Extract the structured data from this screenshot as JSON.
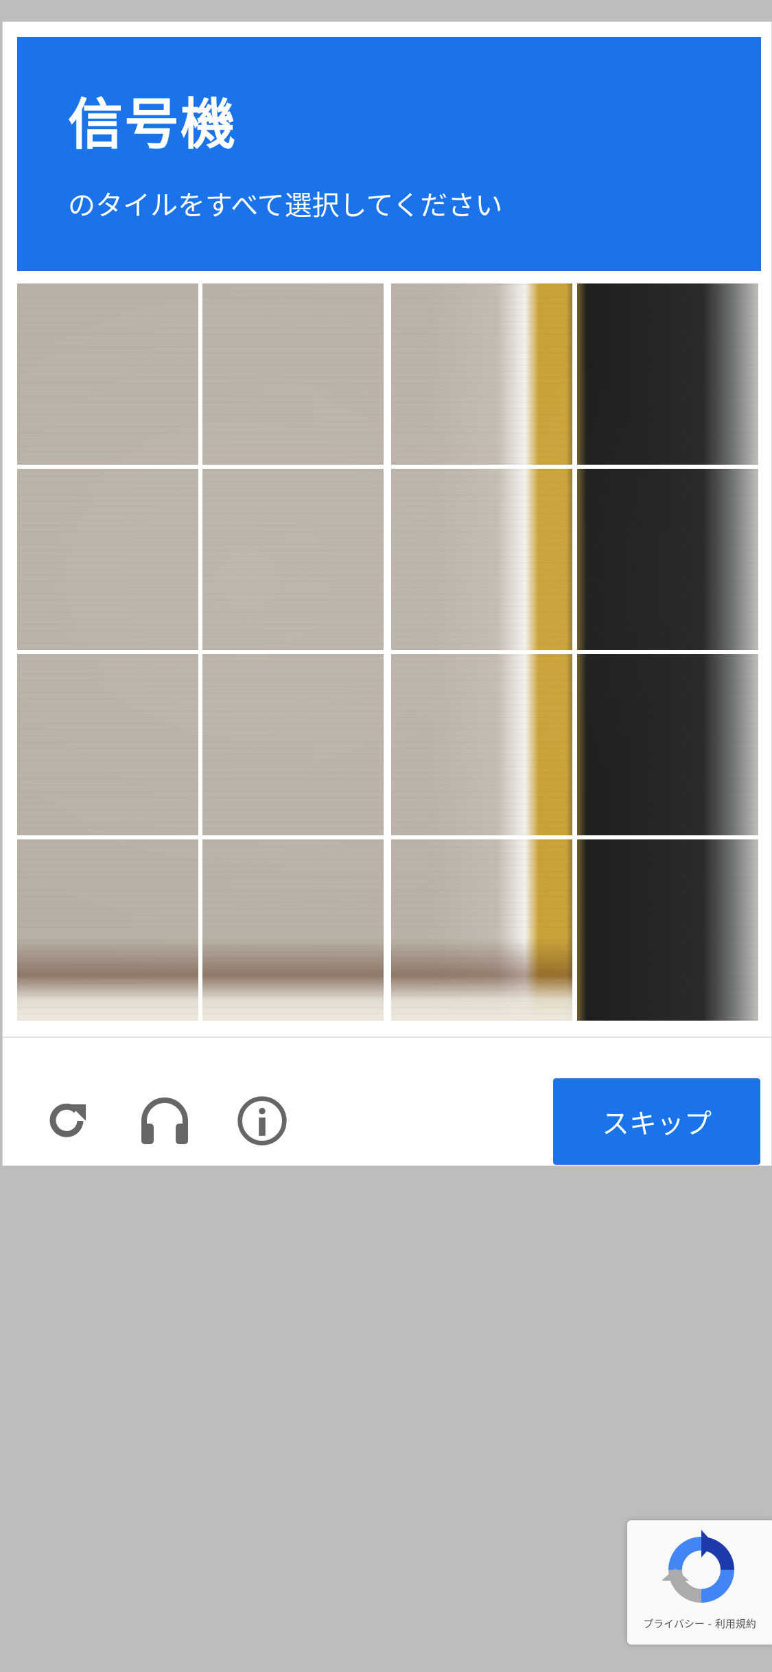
{
  "challenge": {
    "title": "信号機",
    "instruction": "のタイルをすべて選択してください",
    "grid_rows": 4,
    "grid_cols": 4
  },
  "controls": {
    "reload_icon": "reload-icon",
    "audio_icon": "headphones-icon",
    "info_icon": "info-icon",
    "skip_label": "スキップ"
  },
  "badge": {
    "terms_text": "プライバシー - 利用規約"
  },
  "colors": {
    "accent": "#1a73e8",
    "page_background": "#bdbdbd"
  }
}
